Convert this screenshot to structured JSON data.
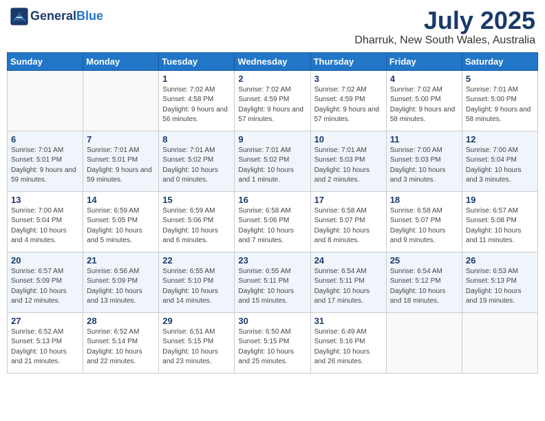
{
  "header": {
    "logo_line1": "General",
    "logo_line2": "Blue",
    "month_year": "July 2025",
    "location": "Dharruk, New South Wales, Australia"
  },
  "weekdays": [
    "Sunday",
    "Monday",
    "Tuesday",
    "Wednesday",
    "Thursday",
    "Friday",
    "Saturday"
  ],
  "weeks": [
    [
      {
        "day": "",
        "info": ""
      },
      {
        "day": "",
        "info": ""
      },
      {
        "day": "1",
        "info": "Sunrise: 7:02 AM\nSunset: 4:58 PM\nDaylight: 9 hours and 56 minutes."
      },
      {
        "day": "2",
        "info": "Sunrise: 7:02 AM\nSunset: 4:59 PM\nDaylight: 9 hours and 57 minutes."
      },
      {
        "day": "3",
        "info": "Sunrise: 7:02 AM\nSunset: 4:59 PM\nDaylight: 9 hours and 57 minutes."
      },
      {
        "day": "4",
        "info": "Sunrise: 7:02 AM\nSunset: 5:00 PM\nDaylight: 9 hours and 58 minutes."
      },
      {
        "day": "5",
        "info": "Sunrise: 7:01 AM\nSunset: 5:00 PM\nDaylight: 9 hours and 58 minutes."
      }
    ],
    [
      {
        "day": "6",
        "info": "Sunrise: 7:01 AM\nSunset: 5:01 PM\nDaylight: 9 hours and 59 minutes."
      },
      {
        "day": "7",
        "info": "Sunrise: 7:01 AM\nSunset: 5:01 PM\nDaylight: 9 hours and 59 minutes."
      },
      {
        "day": "8",
        "info": "Sunrise: 7:01 AM\nSunset: 5:02 PM\nDaylight: 10 hours and 0 minutes."
      },
      {
        "day": "9",
        "info": "Sunrise: 7:01 AM\nSunset: 5:02 PM\nDaylight: 10 hours and 1 minute."
      },
      {
        "day": "10",
        "info": "Sunrise: 7:01 AM\nSunset: 5:03 PM\nDaylight: 10 hours and 2 minutes."
      },
      {
        "day": "11",
        "info": "Sunrise: 7:00 AM\nSunset: 5:03 PM\nDaylight: 10 hours and 3 minutes."
      },
      {
        "day": "12",
        "info": "Sunrise: 7:00 AM\nSunset: 5:04 PM\nDaylight: 10 hours and 3 minutes."
      }
    ],
    [
      {
        "day": "13",
        "info": "Sunrise: 7:00 AM\nSunset: 5:04 PM\nDaylight: 10 hours and 4 minutes."
      },
      {
        "day": "14",
        "info": "Sunrise: 6:59 AM\nSunset: 5:05 PM\nDaylight: 10 hours and 5 minutes."
      },
      {
        "day": "15",
        "info": "Sunrise: 6:59 AM\nSunset: 5:06 PM\nDaylight: 10 hours and 6 minutes."
      },
      {
        "day": "16",
        "info": "Sunrise: 6:58 AM\nSunset: 5:06 PM\nDaylight: 10 hours and 7 minutes."
      },
      {
        "day": "17",
        "info": "Sunrise: 6:58 AM\nSunset: 5:07 PM\nDaylight: 10 hours and 8 minutes."
      },
      {
        "day": "18",
        "info": "Sunrise: 6:58 AM\nSunset: 5:07 PM\nDaylight: 10 hours and 9 minutes."
      },
      {
        "day": "19",
        "info": "Sunrise: 6:57 AM\nSunset: 5:08 PM\nDaylight: 10 hours and 11 minutes."
      }
    ],
    [
      {
        "day": "20",
        "info": "Sunrise: 6:57 AM\nSunset: 5:09 PM\nDaylight: 10 hours and 12 minutes."
      },
      {
        "day": "21",
        "info": "Sunrise: 6:56 AM\nSunset: 5:09 PM\nDaylight: 10 hours and 13 minutes."
      },
      {
        "day": "22",
        "info": "Sunrise: 6:55 AM\nSunset: 5:10 PM\nDaylight: 10 hours and 14 minutes."
      },
      {
        "day": "23",
        "info": "Sunrise: 6:55 AM\nSunset: 5:11 PM\nDaylight: 10 hours and 15 minutes."
      },
      {
        "day": "24",
        "info": "Sunrise: 6:54 AM\nSunset: 5:11 PM\nDaylight: 10 hours and 17 minutes."
      },
      {
        "day": "25",
        "info": "Sunrise: 6:54 AM\nSunset: 5:12 PM\nDaylight: 10 hours and 18 minutes."
      },
      {
        "day": "26",
        "info": "Sunrise: 6:53 AM\nSunset: 5:13 PM\nDaylight: 10 hours and 19 minutes."
      }
    ],
    [
      {
        "day": "27",
        "info": "Sunrise: 6:52 AM\nSunset: 5:13 PM\nDaylight: 10 hours and 21 minutes."
      },
      {
        "day": "28",
        "info": "Sunrise: 6:52 AM\nSunset: 5:14 PM\nDaylight: 10 hours and 22 minutes."
      },
      {
        "day": "29",
        "info": "Sunrise: 6:51 AM\nSunset: 5:15 PM\nDaylight: 10 hours and 23 minutes."
      },
      {
        "day": "30",
        "info": "Sunrise: 6:50 AM\nSunset: 5:15 PM\nDaylight: 10 hours and 25 minutes."
      },
      {
        "day": "31",
        "info": "Sunrise: 6:49 AM\nSunset: 5:16 PM\nDaylight: 10 hours and 26 minutes."
      },
      {
        "day": "",
        "info": ""
      },
      {
        "day": "",
        "info": ""
      }
    ]
  ]
}
